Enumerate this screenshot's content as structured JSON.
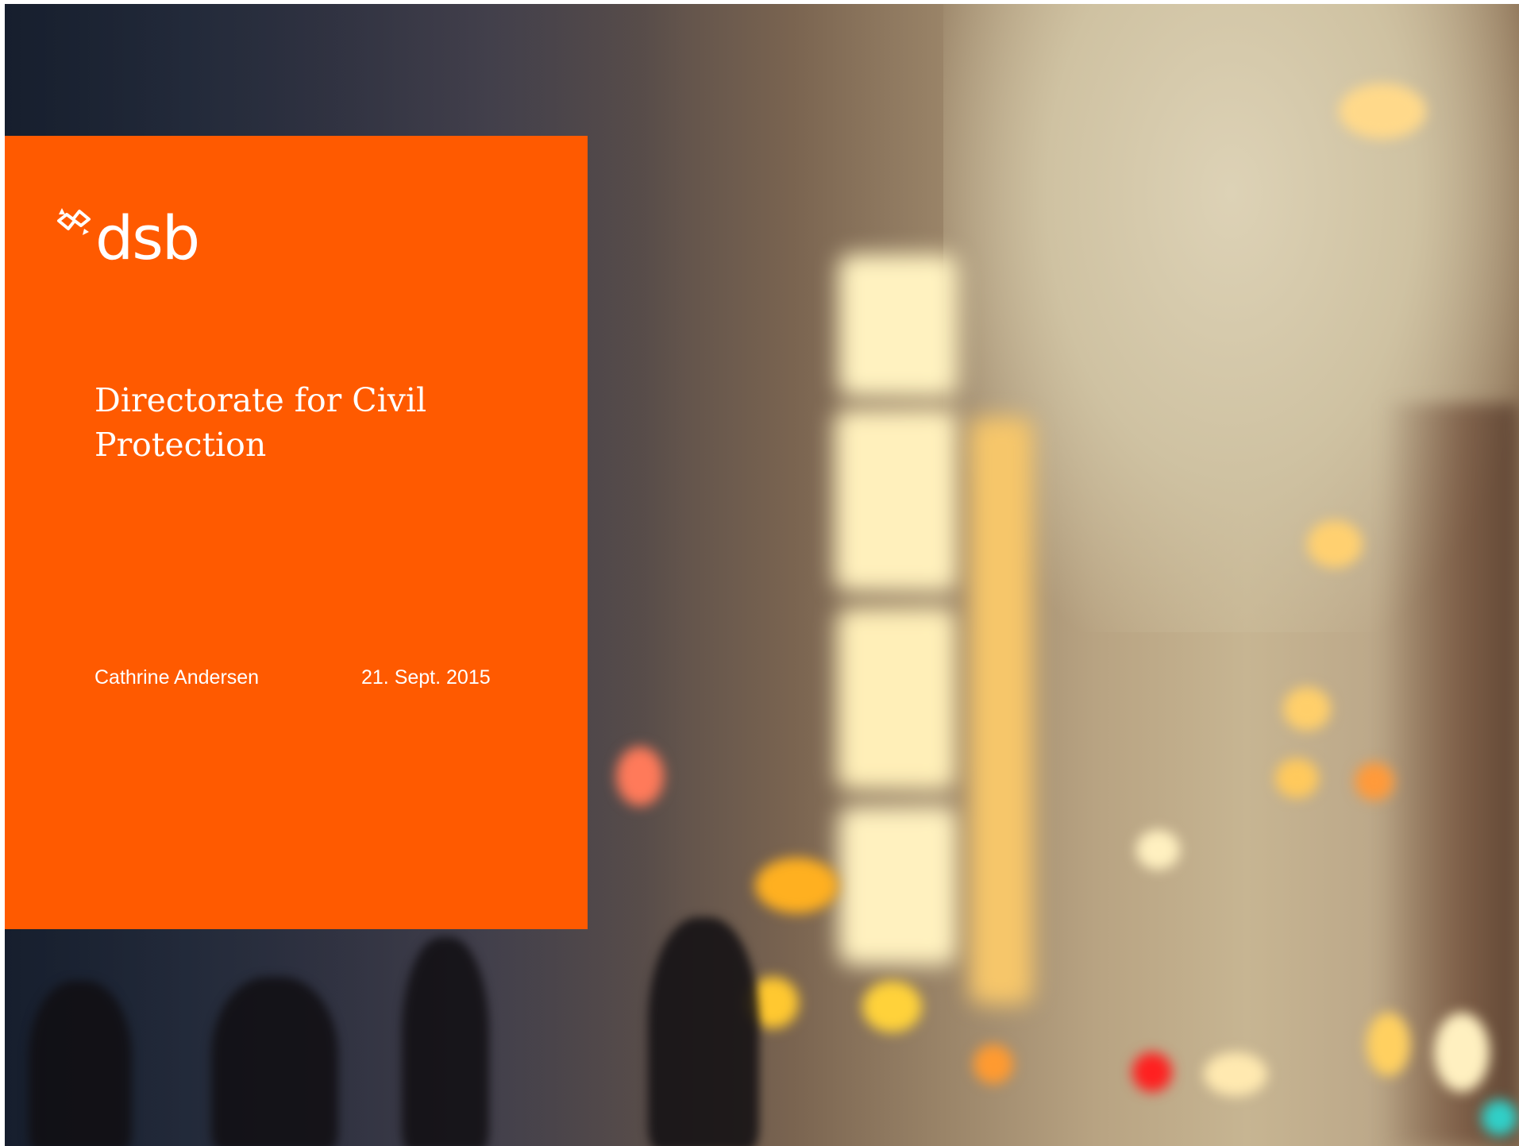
{
  "slide": {
    "logo": {
      "text": "dsb",
      "mark_icon": "dsb-star-logo-icon"
    },
    "title": "Directorate for Civil Protection",
    "author": "Cathrine Andersen",
    "date": "21. Sept. 2015"
  },
  "colors": {
    "panel_orange": "#ff5a00",
    "text_white": "#ffffff"
  }
}
